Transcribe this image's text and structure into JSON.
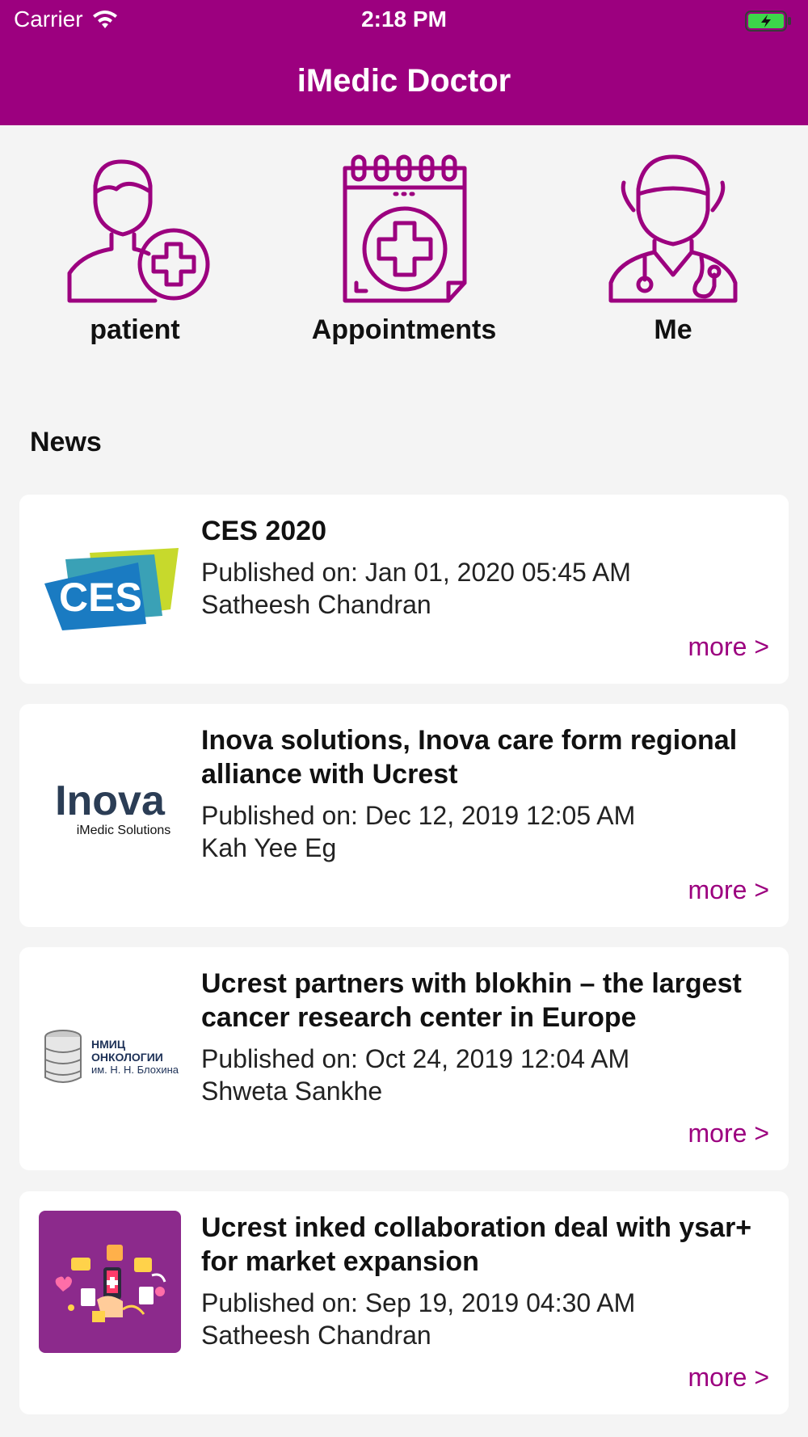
{
  "status_bar": {
    "carrier": "Carrier",
    "time": "2:18 PM"
  },
  "header": {
    "title": "iMedic Doctor"
  },
  "theme": {
    "accent": "#9c007f",
    "battery_green": "#3cd64a"
  },
  "quick_actions": [
    {
      "label": "patient",
      "icon": "add-patient-icon"
    },
    {
      "label": "Appointments",
      "icon": "calendar-medical-icon"
    },
    {
      "label": "Me",
      "icon": "doctor-icon"
    }
  ],
  "news": {
    "heading": "News",
    "items": [
      {
        "title": "CES 2020",
        "published": "Published on: Jan 01, 2020 05:45 AM",
        "author": "Satheesh Chandran",
        "more": "more >",
        "thumb": "ces-logo"
      },
      {
        "title": "Inova solutions, Inova care form regional alliance with Ucrest",
        "published": "Published on: Dec 12, 2019 12:05 AM",
        "author": "Kah Yee Eg",
        "more": "more >",
        "thumb": "inova-logo",
        "thumb_text": "Inova",
        "thumb_subtext": "iMedic Solutions"
      },
      {
        "title": "Ucrest partners with blokhin – the largest cancer research center in Europe",
        "published": "Published on: Oct 24, 2019 12:04 AM",
        "author": "Shweta Sankhe",
        "more": "more >",
        "thumb": "blokhin-logo",
        "thumb_lines": [
          "НМИЦ",
          "ОНКОЛОГИИ",
          "им. Н. Н. Блохина"
        ]
      },
      {
        "title": "Ucrest inked collaboration deal with ysar+ for market expansion",
        "published": "Published on: Sep 19, 2019 04:30 AM",
        "author": "Satheesh Chandran",
        "more": "more >",
        "thumb": "collaboration-illustration"
      }
    ]
  }
}
